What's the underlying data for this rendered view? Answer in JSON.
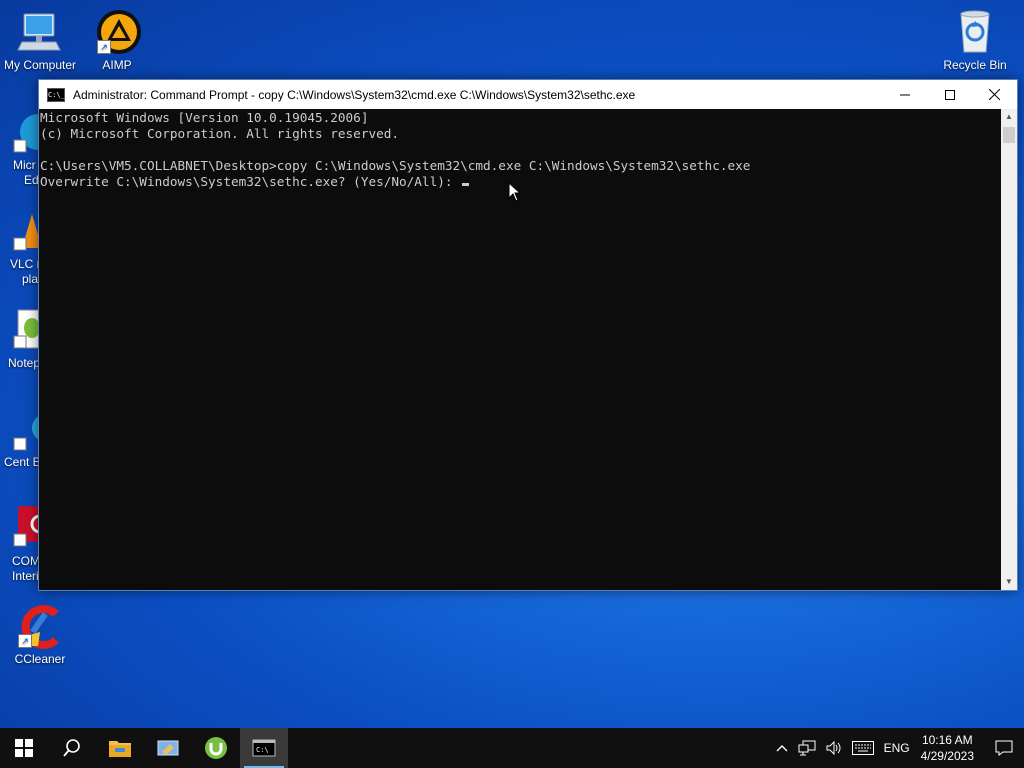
{
  "desktop": {
    "icons": [
      {
        "label": "My Computer"
      },
      {
        "label": "AIMP"
      },
      {
        "label": "Recycle Bin"
      },
      {
        "label": "CCleaner"
      }
    ],
    "partial_labels": {
      "edge_1": "Micr",
      "edge_2": "Ed",
      "vlc_1": "VLC r",
      "vlc_2": "pla",
      "notepad": "Notep",
      "cent": "Cent B",
      "com_1": "COM",
      "com_2": "Interi"
    }
  },
  "window": {
    "title": "Administrator:  Command Prompt - copy  C:\\Windows\\System32\\cmd.exe C:\\Windows\\System32\\sethc.exe",
    "app_icon_text": "C:\\_",
    "minimize_icon": "minimize-icon",
    "maximize_icon": "maximize-icon",
    "close_icon": "close-icon"
  },
  "console": {
    "line1": "Microsoft Windows [Version 10.0.19045.2006]",
    "line2": "(c) Microsoft Corporation. All rights reserved.",
    "line3": "",
    "line4": "C:\\Users\\VM5.COLLABNET\\Desktop>copy C:\\Windows\\System32\\cmd.exe C:\\Windows\\System32\\sethc.exe",
    "line5": "Overwrite C:\\Windows\\System32\\sethc.exe? (Yes/No/All): "
  },
  "taskbar": {
    "language": "ENG",
    "time": "10:16 AM",
    "date": "4/29/2023"
  },
  "colors": {
    "console_bg": "#0c0c0c",
    "console_text": "#cccccc",
    "taskbar_bg": "#101010",
    "accent": "#76b9ed"
  }
}
